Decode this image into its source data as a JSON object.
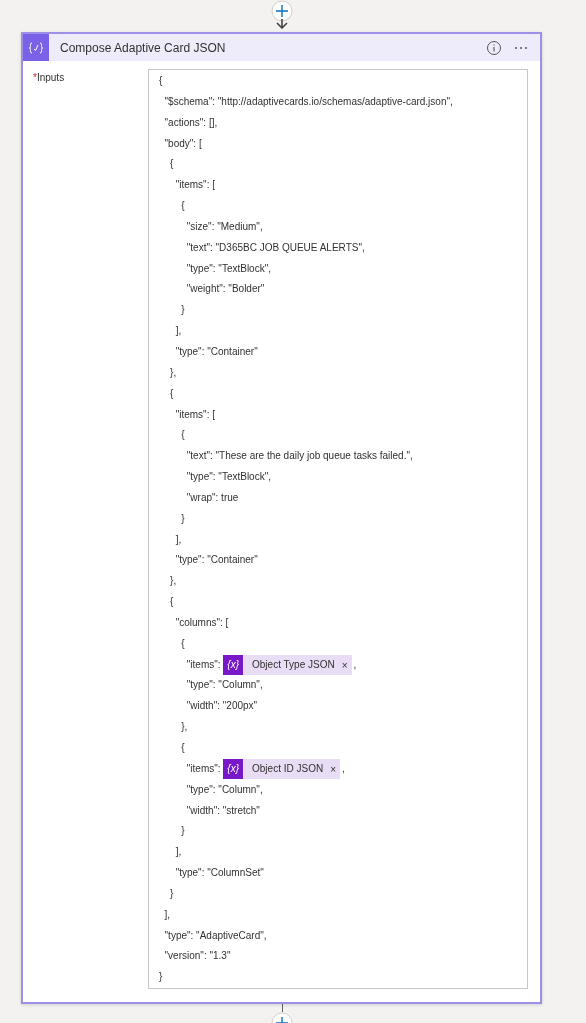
{
  "card": {
    "title": "Compose Adaptive Card JSON",
    "fields": [
      {
        "label": "Inputs",
        "required": true,
        "required_mark": "*",
        "lines": [
          {
            "kind": "text",
            "text": "{"
          },
          {
            "kind": "text",
            "text": "  \"$schema\": \"http://adaptivecards.io/schemas/adaptive-card.json\","
          },
          {
            "kind": "text",
            "text": "  \"actions\": [],"
          },
          {
            "kind": "text",
            "text": "  \"body\": ["
          },
          {
            "kind": "text",
            "text": "    {"
          },
          {
            "kind": "text",
            "text": "      \"items\": ["
          },
          {
            "kind": "text",
            "text": "        {"
          },
          {
            "kind": "text",
            "text": "          \"size\": \"Medium\","
          },
          {
            "kind": "text",
            "text": "          \"text\": \"D365BC JOB QUEUE ALERTS\","
          },
          {
            "kind": "text",
            "text": "          \"type\": \"TextBlock\","
          },
          {
            "kind": "text",
            "text": "          \"weight\": \"Bolder\""
          },
          {
            "kind": "text",
            "text": "        }"
          },
          {
            "kind": "text",
            "text": "      ],"
          },
          {
            "kind": "text",
            "text": "      \"type\": \"Container\""
          },
          {
            "kind": "text",
            "text": "    },"
          },
          {
            "kind": "text",
            "text": "    {"
          },
          {
            "kind": "text",
            "text": "      \"items\": ["
          },
          {
            "kind": "text",
            "text": "        {"
          },
          {
            "kind": "text",
            "text": "          \"text\": \"These are the daily job queue tasks failed.\","
          },
          {
            "kind": "text",
            "text": "          \"type\": \"TextBlock\","
          },
          {
            "kind": "text",
            "text": "          \"wrap\": true"
          },
          {
            "kind": "text",
            "text": "        }"
          },
          {
            "kind": "text",
            "text": "      ],"
          },
          {
            "kind": "text",
            "text": "      \"type\": \"Container\""
          },
          {
            "kind": "text",
            "text": "    },"
          },
          {
            "kind": "text",
            "text": "    {"
          },
          {
            "kind": "text",
            "text": "      \"columns\": ["
          },
          {
            "kind": "text",
            "text": "        {"
          },
          {
            "kind": "token",
            "text": "          \"items\": ",
            "token_icon": "{x}",
            "token_label": "Object Type JSON",
            "remove": "×",
            "after": ","
          },
          {
            "kind": "text",
            "text": "          \"type\": \"Column\","
          },
          {
            "kind": "text",
            "text": "          \"width\": \"200px\""
          },
          {
            "kind": "text",
            "text": "        },"
          },
          {
            "kind": "text",
            "text": "        {"
          },
          {
            "kind": "token",
            "text": "          \"items\": ",
            "token_icon": "{x}",
            "token_label": "Object ID JSON",
            "remove": "×",
            "after": ","
          },
          {
            "kind": "text",
            "text": "          \"type\": \"Column\","
          },
          {
            "kind": "text",
            "text": "          \"width\": \"stretch\""
          },
          {
            "kind": "text",
            "text": "        }"
          },
          {
            "kind": "text",
            "text": "      ],"
          },
          {
            "kind": "text",
            "text": "      \"type\": \"ColumnSet\""
          },
          {
            "kind": "text",
            "text": "    }"
          },
          {
            "kind": "text",
            "text": "  ],"
          },
          {
            "kind": "text",
            "text": "  \"type\": \"AdaptiveCard\","
          },
          {
            "kind": "text",
            "text": "  \"version\": \"1.3\""
          },
          {
            "kind": "text",
            "text": "}"
          }
        ]
      }
    ]
  }
}
